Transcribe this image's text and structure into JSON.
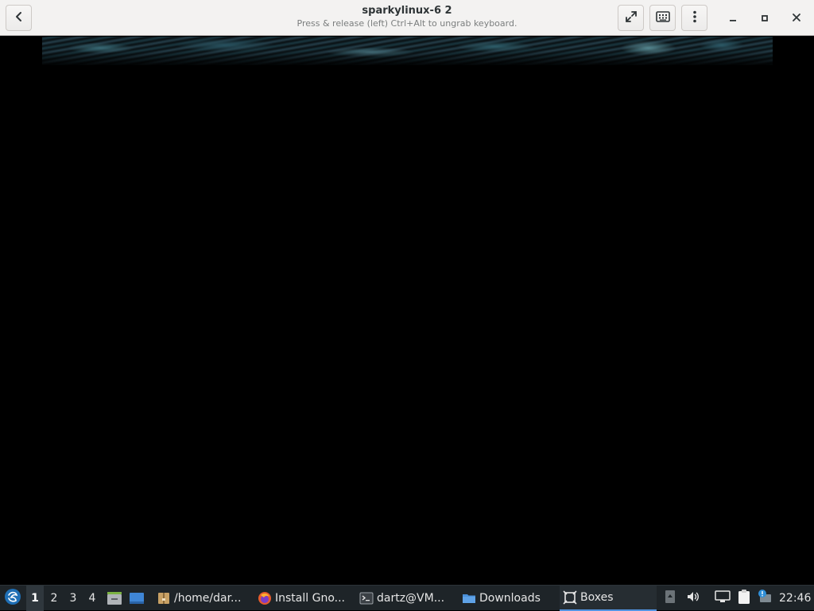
{
  "window": {
    "title": "sparkylinux-6 2",
    "subtitle": "Press & release (left) Ctrl+Alt to ungrab keyboard."
  },
  "header": {
    "back_icon": "chevron-left-icon",
    "fullscreen_icon": "fullscreen-icon",
    "keyboard_icon": "keyboard-icon",
    "menu_icon": "vertical-dots-menu-icon",
    "window_controls": [
      "minimize-icon",
      "maximize-icon",
      "close-icon"
    ]
  },
  "taskbar": {
    "workspaces": [
      "1",
      "2",
      "3",
      "4"
    ],
    "active_workspace": "1",
    "launchers": [
      "file-manager-icon",
      "show-desktop-icon"
    ],
    "tasks": [
      {
        "label": "/home/dar...",
        "icon": "archive-icon"
      },
      {
        "label": "Install Gno...",
        "icon": "firefox-icon"
      },
      {
        "label": "dartz@VM...",
        "icon": "terminal-icon"
      },
      {
        "label": "Downloads",
        "icon": "folder-icon"
      },
      {
        "label": "Boxes",
        "icon": "boxes-icon",
        "active": true
      }
    ],
    "tray": [
      "tray-arrow-icon",
      "volume-icon",
      "network-icon",
      "clipboard-icon",
      "updates-icon"
    ],
    "clock": "22:46"
  },
  "colors": {
    "header_bg": "#f3f2f1",
    "taskbar_bg": "#1e2428",
    "accent": "#5294e2",
    "display_bg": "#000000"
  }
}
